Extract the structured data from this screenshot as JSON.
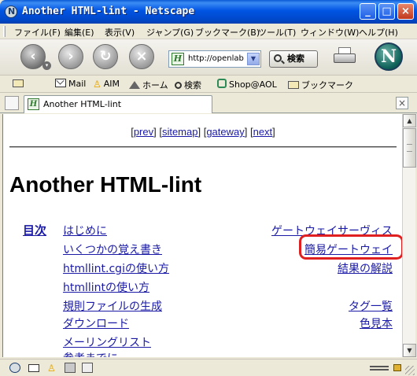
{
  "window": {
    "title": "Another HTML-lint - Netscape",
    "controls": {
      "minimize": "_",
      "maximize": "□",
      "close": "×"
    }
  },
  "menubar": {
    "items": [
      {
        "label": "ファイル(F)"
      },
      {
        "label": "編集(E)"
      },
      {
        "label": "表示(V)"
      },
      {
        "label": "ジャンプ(G)"
      },
      {
        "label": "ブックマーク(B)"
      },
      {
        "label": "ツール(T)"
      },
      {
        "label": "ウィンドウ(W)"
      },
      {
        "label": "ヘルプ(H)"
      }
    ]
  },
  "navbar": {
    "url": "http://openlab.",
    "search_label": "検索",
    "logo": "N"
  },
  "personal_toolbar": {
    "items": [
      {
        "label": "Mail",
        "icon": "mail-icon"
      },
      {
        "label": "AIM",
        "icon": "aim-icon"
      },
      {
        "label": "ホーム",
        "icon": "home-icon"
      },
      {
        "label": "検索",
        "icon": "search-icon"
      },
      {
        "label": "Shop@AOL",
        "icon": "shop-icon"
      },
      {
        "label": "ブックマーク",
        "icon": "folder-icon"
      }
    ]
  },
  "tabs": [
    {
      "label": "Another HTML-lint",
      "active": true
    }
  ],
  "content": {
    "topnav": {
      "prev": "prev",
      "sitemap": "sitemap",
      "gateway": "gateway",
      "next": "next"
    },
    "heading": "Another HTML-lint",
    "toc_label": "目次",
    "left_links": [
      "はじめに",
      "いくつかの覚え書き",
      "htmllint.cgiの使い方",
      "htmllintの使い方",
      "規則ファイルの生成",
      "ダウンロード",
      "メーリングリスト",
      "参考までに"
    ],
    "right_links": [
      "ゲートウェイサーヴィス",
      "簡易ゲートウェイ",
      "結果の解説",
      "タグ一覧",
      "色見本"
    ],
    "highlighted_link": "簡易ゲートウェイ"
  },
  "colors": {
    "link": "#1a1aa6",
    "highlight_border": "#e02020",
    "titlebar": "#0054e3"
  }
}
